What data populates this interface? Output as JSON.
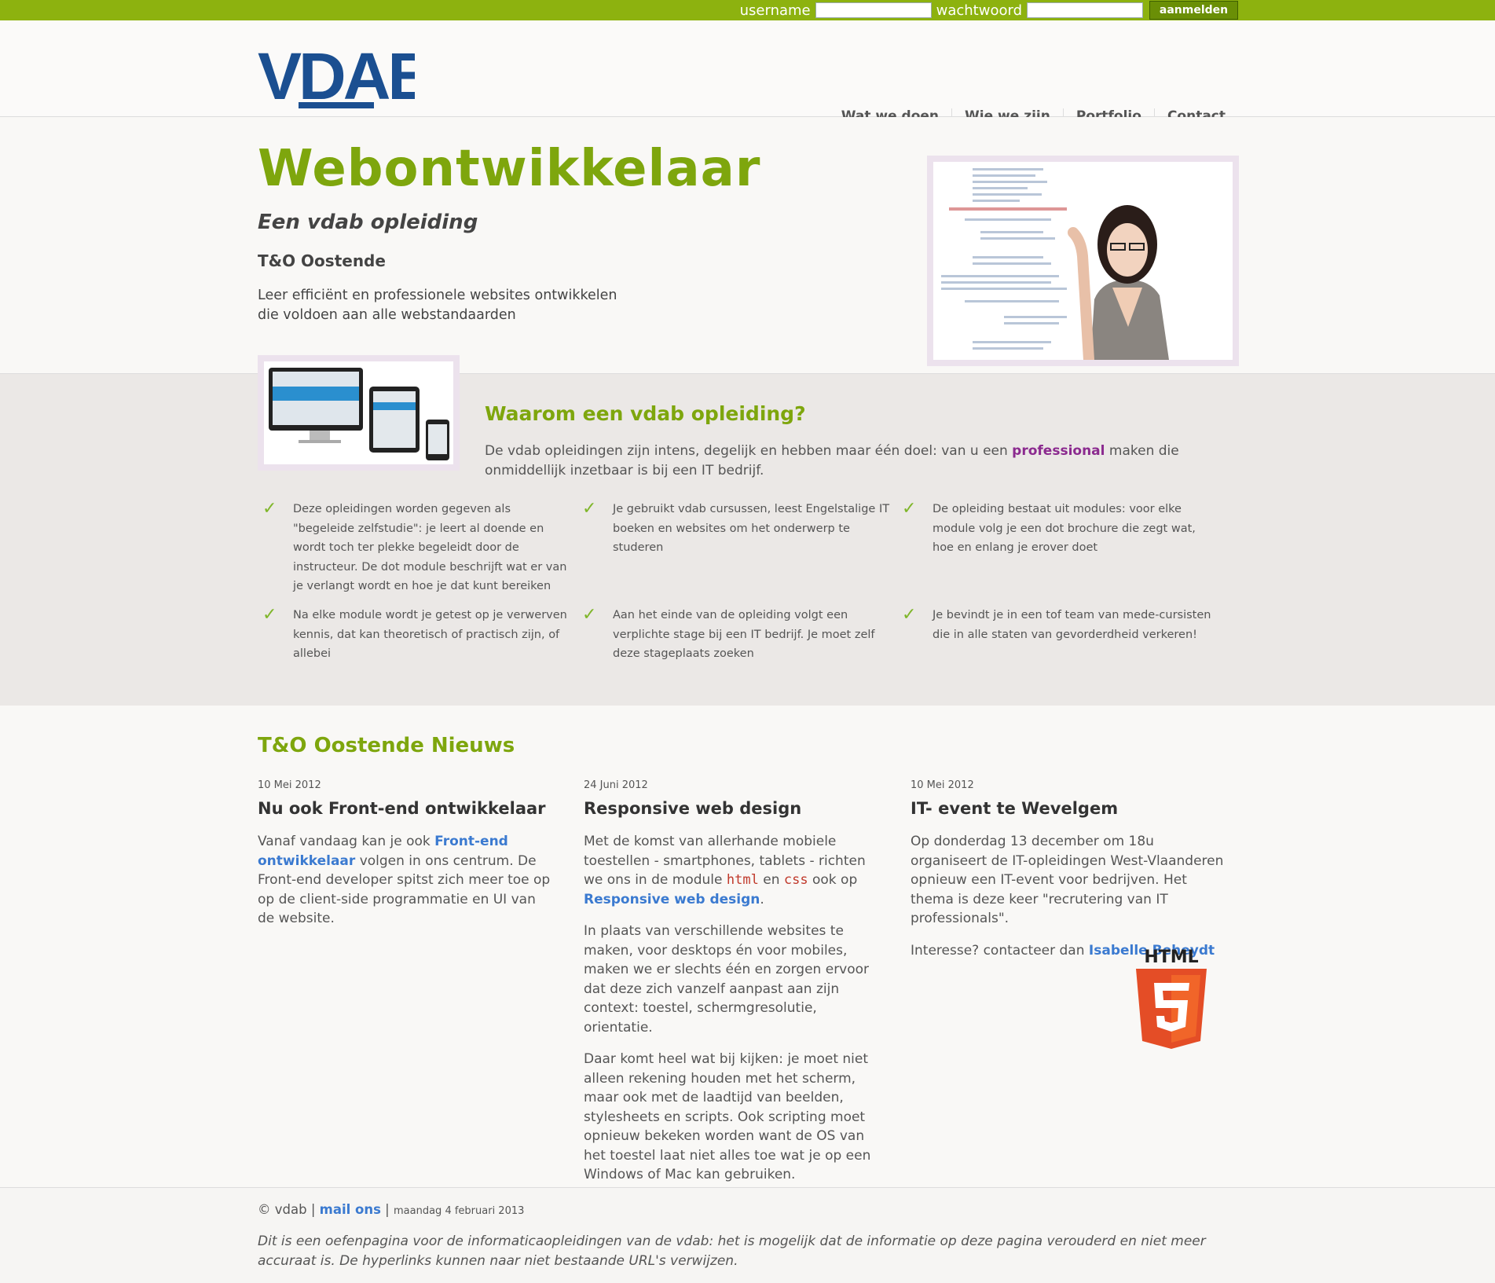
{
  "login": {
    "username_label": "username",
    "password_label": "wachtwoord",
    "submit_label": "aanmelden"
  },
  "brand": {
    "logo_text": "VDAB",
    "primary": "#1b4f91",
    "accent": "#7ea60d",
    "bar": "#8db20f"
  },
  "nav": [
    "Wat we doen",
    "Wie we zijn",
    "Portfolio",
    "Contact"
  ],
  "hero": {
    "title": "Webontwikkelaar",
    "subtitle": "Een vdab opleiding",
    "location": "T&O Oostende",
    "lead_1": "Leer efficiënt en professionele websites ontwikkelen",
    "lead_2": "die voldoen aan alle webstandaarden"
  },
  "why": {
    "title": "Waarom een vdab opleiding?",
    "text_before": "De vdab opleidingen zijn intens, degelijk en hebben maar één doel: van u een",
    "highlight": "professional",
    "text_after": "maken die onmiddellijk inzetbaar is bij een IT bedrijf.",
    "items": [
      "Deze opleidingen worden gegeven als \"begeleide zelfstudie\": je leert al doende en wordt toch ter plekke begeleidt door de instructeur. De dot module beschrijft wat er van je verlangt wordt en hoe je dat kunt bereiken",
      "Je gebruikt vdab cursussen, leest Engelstalige IT boeken en websites om het onderwerp te studeren",
      "De opleiding bestaat uit modules: voor elke module volg je een dot brochure die zegt wat, hoe en enlang je erover doet",
      "Na elke module wordt je getest op je verwerven kennis, dat kan theoretisch of practisch zijn, of allebei",
      "Aan het einde van de opleiding volgt een verplichte stage bij een IT bedrijf. Je moet zelf deze stageplaats zoeken",
      "Je bevindt je in een tof team van mede-cursisten die in alle staten van gevorderdheid verkeren!"
    ]
  },
  "news": {
    "title": "T&O Oostende Nieuws",
    "col1": {
      "date": "10 Mei 2012",
      "title": "Nu ook Front-end ontwikkelaar",
      "p_a": "Vanaf vandaag kan je ook",
      "link": "Front-end ontwikkelaar",
      "p_b": "volgen in ons centrum. De Front-end developer spitst zich meer toe op op de client-side programmatie en UI van de website."
    },
    "col2": {
      "date": "24 Juni 2012",
      "title": "Responsive web design",
      "p1_a": "Met de komst van allerhande mobiele toestellen - smartphones, tablets - richten we ons in de module",
      "code1": "html",
      "p1_mid": "en",
      "code2": "css",
      "p1_b": "ook op",
      "link": "Responsive web design",
      "p1_end": ".",
      "p2": "In plaats van verschillende websites te maken, voor desktops én voor mobiles, maken we er slechts één en zorgen ervoor dat deze zich vanzelf aanpast aan zijn context: toestel, schermgresolutie, orientatie.",
      "p3": "Daar komt heel wat bij kijken: je moet niet alleen rekening houden met het scherm, maar ook met de laadtijd van beelden, stylesheets en scripts. Ook scripting moet opnieuw bekeken worden want de OS van het toestel laat niet alles toe wat je op een Windows of Mac kan gebruiken."
    },
    "col3": {
      "date": "10 Mei 2012",
      "title": "IT- event te Wevelgem",
      "p1": "Op donderdag 13 december om 18u organiseert de IT-opleidingen West-Vlaanderen opnieuw een IT-event voor bedrijven. Het thema is deze keer \"recrutering van IT professionals\".",
      "p2_a": "Interesse? contacteer dan",
      "link": "Isabelle Beheydt",
      "badge_label": "HTML"
    }
  },
  "footer": {
    "copyright": "© vdab",
    "link": "mail ons",
    "date": "maandag 4 februari 2013",
    "note": "Dit is een oefenpagina voor de informaticaopleidingen van de vdab: het is mogelijk dat de informatie op deze pagina verouderd en niet meer accuraat is. De hyperlinks kunnen naar niet bestaande URL's verwijzen."
  }
}
